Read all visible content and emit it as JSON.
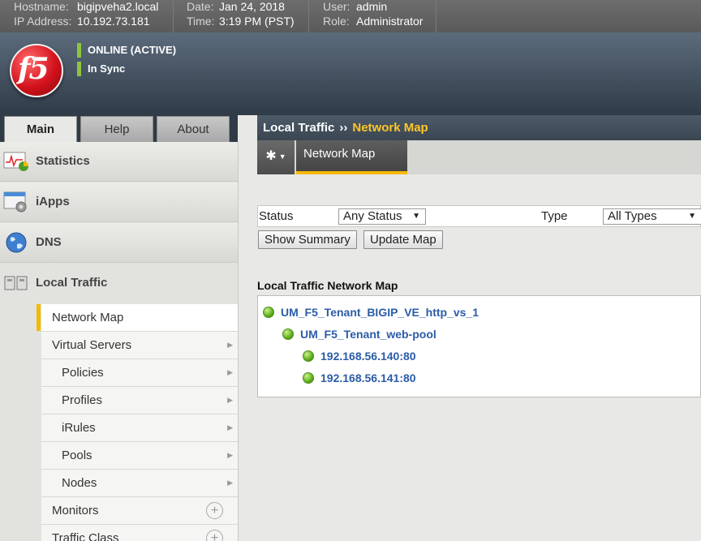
{
  "topbar": {
    "hostname_label": "Hostname:",
    "hostname": "bigipveha2.local",
    "ip_label": "IP Address:",
    "ip": "10.192.73.181",
    "date_label": "Date:",
    "date": "Jan 24, 2018",
    "time_label": "Time:",
    "time": "3:19 PM (PST)",
    "user_label": "User:",
    "user": "admin",
    "role_label": "Role:",
    "role": "Administrator"
  },
  "banner": {
    "logo_text": "f5",
    "status_online": "ONLINE (ACTIVE)",
    "status_sync": "In Sync"
  },
  "tabs": [
    {
      "label": "Main",
      "active": true
    },
    {
      "label": "Help",
      "active": false
    },
    {
      "label": "About",
      "active": false
    }
  ],
  "breadcrumb": {
    "section": "Local Traffic",
    "separator": "››",
    "current": "Network Map"
  },
  "sidebar": {
    "sections": [
      {
        "label": "Statistics",
        "icon": "statistics-icon"
      },
      {
        "label": "iApps",
        "icon": "iapps-icon"
      },
      {
        "label": "DNS",
        "icon": "dns-globe-icon"
      },
      {
        "label": "Local Traffic",
        "icon": "local-traffic-icon"
      }
    ],
    "items": [
      {
        "label": "Network Map",
        "active": true
      },
      {
        "label": "Virtual Servers",
        "arrow": "▶"
      },
      {
        "label": "Policies",
        "arrow": "▶"
      },
      {
        "label": "Profiles",
        "arrow": "▶"
      },
      {
        "label": "iRules",
        "arrow": "▶"
      },
      {
        "label": "Pools",
        "arrow": "▶"
      },
      {
        "label": "Nodes",
        "arrow": "▶"
      },
      {
        "label": "Monitors",
        "plus": "+"
      },
      {
        "label": "Traffic Class",
        "plus": "+"
      }
    ]
  },
  "subtabs": {
    "gear": "✱",
    "caret": "▼",
    "active_tab": "Network Map"
  },
  "filter": {
    "status_label": "Status",
    "status_value": "Any Status",
    "type_label": "Type",
    "type_value": "All Types",
    "dropdown_glyph": "▼"
  },
  "buttons": {
    "show_summary": "Show Summary",
    "update_map": "Update Map"
  },
  "map": {
    "title": "Local Traffic Network Map",
    "virtual_server": "UM_F5_Tenant_BIGIP_VE_http_vs_1",
    "pool": "UM_F5_Tenant_web-pool",
    "members": [
      "192.168.56.140:80",
      "192.168.56.141:80"
    ],
    "status_color": "#5fae1f"
  },
  "colors": {
    "accent": "#f5b800",
    "link": "#2b5ca8",
    "status_green": "#8cc63f"
  }
}
